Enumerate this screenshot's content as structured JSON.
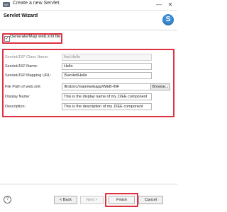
{
  "window": {
    "title": "Create a new Servlet.",
    "minimize_glyph": "—",
    "close_glyph": "✕",
    "app_icon": "eclipse-app-icon"
  },
  "header": {
    "title": "Servlet Wizard",
    "logo_letter": "S",
    "logo_color": "#3f8fd9"
  },
  "options": {
    "generate_map": {
      "label": "Generate/Map web.xml file",
      "checked": true,
      "check_glyph": "✓"
    }
  },
  "form": {
    "rows": [
      {
        "label": "Servlet/JSP Class Name:",
        "value": "first.Hello",
        "disabled": true
      },
      {
        "label": "Servlet/JSP Name:",
        "value": "Hello",
        "disabled": false
      },
      {
        "label": "Servlet/JSP Mapping URL:",
        "value": "/Servlet/Hello",
        "disabled": false
      },
      {
        "label": "File Path of web.xml:",
        "value": "/first/src/main/webapp/WEB-INF",
        "disabled": false
      },
      {
        "label": "Display Name:",
        "value": "This is the display name of my J2EE component",
        "disabled": false
      },
      {
        "label": "Description:",
        "value": "This is the description of my J2EE component",
        "disabled": false
      }
    ],
    "browse_label": "Browse..."
  },
  "footer": {
    "help_glyph": "?",
    "back_label": "< Back",
    "next_label": "Next >",
    "finish_label": "Finish",
    "cancel_label": "Cancel"
  },
  "colors": {
    "highlight": "#e03040"
  }
}
